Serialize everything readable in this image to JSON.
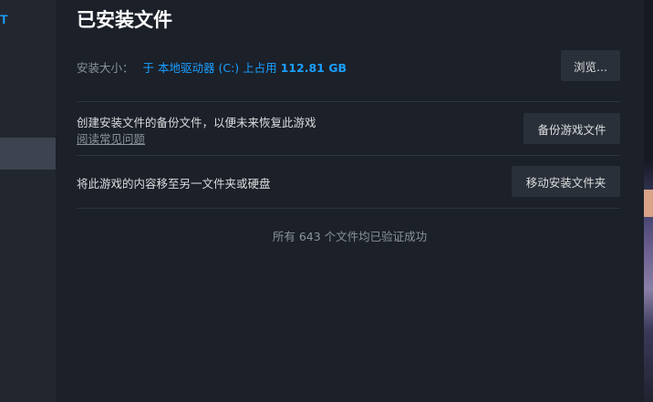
{
  "sidebar": {
    "cut_text": "T"
  },
  "main": {
    "title": "已安装文件",
    "install_size": {
      "label": "安装大小：",
      "value_prefix": "于 本地驱动器 (C:) 上占用 ",
      "value_amount": "112.81 GB"
    },
    "browse_button": "浏览...",
    "backup": {
      "description": "创建安装文件的备份文件，以便未来恢复此游戏",
      "faq_link": "阅读常见问题",
      "button": "备份游戏文件"
    },
    "move": {
      "description": "将此游戏的内容移至另一文件夹或硬盘",
      "button": "移动安装文件夹"
    },
    "verify_status": "所有 643 个文件均已验证成功"
  },
  "colors": {
    "accent": "#1a9fff",
    "panel": "#1b2029",
    "button": "#2a303a",
    "muted_text": "#8b929a"
  }
}
